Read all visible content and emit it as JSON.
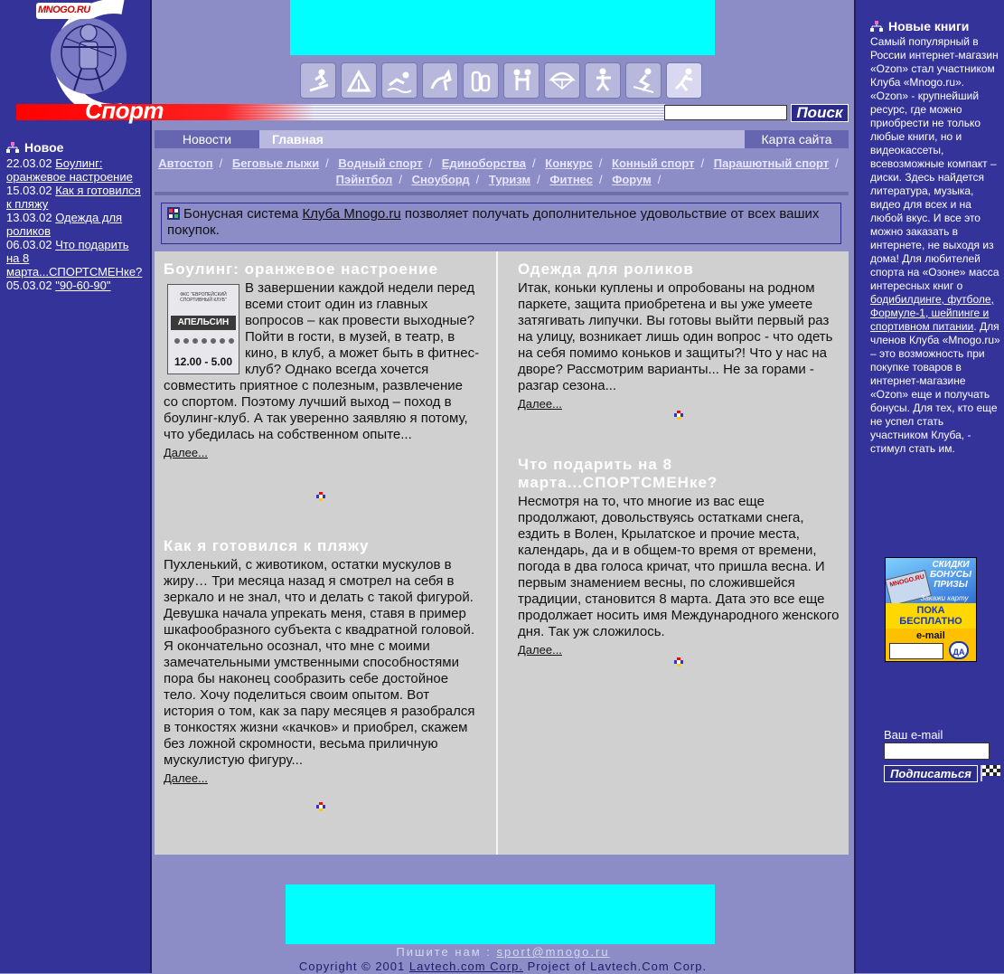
{
  "header": {
    "logo_badge": "MNOGO.RU",
    "logo_word": "Спорт",
    "search_button": "Поиск",
    "search_value": ""
  },
  "sport_icons": [
    "snowboard-icon",
    "tourism-icon",
    "swimming-icon",
    "equestrian-icon",
    "auto-icon",
    "martial-arts-icon",
    "parachute-icon",
    "paintball-icon",
    "ski-icon",
    "fitness-icon"
  ],
  "nav": {
    "news": "Новости",
    "main": "Главная",
    "sitemap": "Карта сайта"
  },
  "categories": [
    "Автостоп",
    "Беговые лыжи",
    "Водный спорт",
    "Единоборства",
    "Конкурс",
    "Конный спорт",
    "Парашютный спорт",
    "Пэйнтбол",
    "Сноуборд",
    "Туризм",
    "Фитнес",
    "Форум"
  ],
  "notice": {
    "before": "Бонусная система ",
    "link": "Клуба Mnogo.ru",
    "after": " позволяет получать дополнительное удовольствие от всех ваших покупок."
  },
  "left_news": {
    "title": "Новое",
    "items": [
      {
        "date": "22.03.02",
        "title": "Боулинг: оранжевое настроение"
      },
      {
        "date": "15.03.02",
        "title": "Как я готовился к пляжу"
      },
      {
        "date": "13.03.02",
        "title": "Одежда для роликов"
      },
      {
        "date": "06.03.02",
        "title": "Что подарить на 8 марта...СПОРТСМЕНке?"
      },
      {
        "date": "05.03.02",
        "title": "\"90-60-90\""
      }
    ]
  },
  "articles": [
    {
      "title": "Боулинг: оранжевое настроение",
      "text": "В завершении каждой недели перед всеми стоит один из главных вопросов – как провести выходные? Пойти в гости, в музей, в театр, в кино, в клуб, а может быть в фитнес-клуб? Однако всегда хочется совместить приятное с полезным, развлечение со спортом. Поэтому лучший выход – поход в боулинг-клуб. А так уверенно заявляю я потому, что убедилась на собственном опыте...",
      "more": "Далее...",
      "image_title": "АПЕЛЬСИН",
      "image_caption": "ФКС \"ЕВРОПЕЙСКИЙ СПОРТИВНЫЙ КЛУБ\"",
      "image_time": "12.00 - 5.00"
    },
    {
      "title": "Как я готовился к пляжу",
      "text": "Пухленький, с животиком, остатки мускулов в жиру… Три месяца назад я смотрел на себя в зеркало и не знал, что и делать с такой фигурой. Девушка начала упрекать меня, ставя в пример шкафообразного субъекта с квадратной головой. Я окончательно осознал, что мне с моими замечательными умственными способностями пора бы наконец сообразить себе достойное тело. Хочу поделиться своим опытом. Вот история о том, как за пару месяцев я разобрался в тонкостях жизни «качков» и приобрел, скажем без ложной скромности, весьма приличную мускулистую фигуру...",
      "more": "Далее..."
    },
    {
      "title": "Одежда для роликов",
      "text": "Итак, коньки куплены и опробованы на родном паркете, защита приобретена и вы уже умеете затягивать липучки. Вы готовы выйти первый раз на улицу, возникает лишь один вопрос - что одеть на себя помимо коньков и защиты?! Что у нас на дворе? Рассмотрим варианты... Не за горами - разгар сезона...",
      "more": "Далее..."
    },
    {
      "title": "Что подарить на 8 марта...СПОРТСМЕНке?",
      "text": "Несмотря на то, что многие из вас еще продолжают, довольствуясь остатками снега, ездить в Волен, Крылатское и прочие места, календарь, да и в общем-то время от времени, погода в два голоса кричат, что пришла весна. И первым знамением весны, по сложившейся традиции, становится 8 марта. Дата это все еще продолжает носить имя Международного женского дня. Так уж сложилось.",
      "more": "Далее..."
    }
  ],
  "right_books": {
    "title": "Новые книги",
    "p1": "Самый популярный в России интернет-магазин «Ozon» стал участником Клуба «Mnogo.ru». «Ozon» - крупнейший ресурс, где можно приобрести не только любые книги, но и видеокассеты, всевозможные компакт – диски. Здесь найдется литература, музыка, видео для всех и на любой вкус. И все это можно заказать в интернете, не выходя из дома! Для любителей спорта на «Озоне» масса интересных книг о ",
    "link": "бодибилдинге, футболе, Формуле-1, шейпинге и спортивном питании",
    "p2": ". Для членов Клуба «Mnogo.ru» – это возможность при покупке товаров в интернет-магазине «Ozon» еще и получать бонусы. Для тех, кто еще не успел стать участником Клуба, - стимул стать им."
  },
  "promo_card": {
    "line1": "СКИДКИ",
    "line2": "БОНУСЫ",
    "line3": "ПРИЗЫ",
    "order": "Закажи карту",
    "free1": "ПОКА",
    "free2": "БЕСПЛАТНО",
    "email": "e-mail",
    "yes": "ДА",
    "card_brand": "MNOGO.RU"
  },
  "subscribe": {
    "label": "Ваш e-mail",
    "button": "Подписаться"
  },
  "footer": {
    "write_label": "Пишите нам : ",
    "email": "sport@mnogo.ru",
    "copyright_before": "Copyright © 2001 ",
    "company": "Lavtech.com Corp.",
    "copyright_after": " Project of Lavtech.Com Corp."
  },
  "colors": {
    "sidebar": "#33339a",
    "background": "#8c8cc6",
    "banner": "#00ffff",
    "content": "#d0d0d0",
    "accent_red": "#ff0000"
  }
}
